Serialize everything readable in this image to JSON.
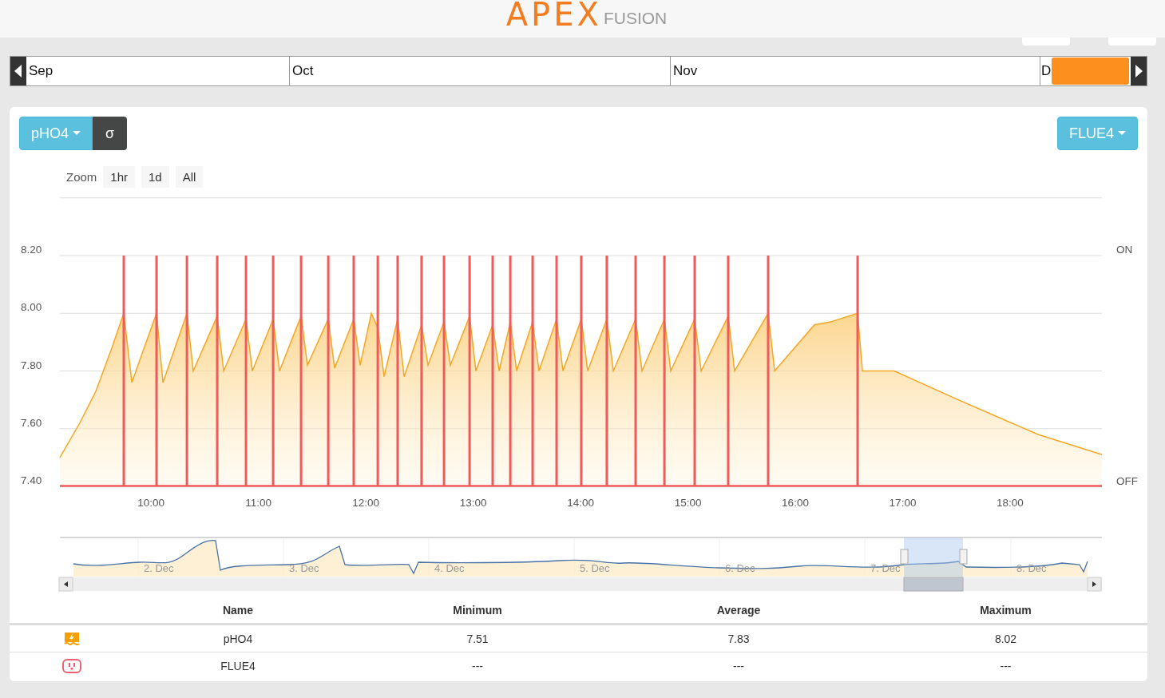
{
  "header": {
    "logo_main": "APEX",
    "logo_sub": "FUSION"
  },
  "timeline": {
    "months": [
      "Sep",
      "Oct",
      "Nov",
      "D"
    ]
  },
  "controls": {
    "sigma_button": "σ",
    "outlet_button": "FLUE4"
  },
  "zoom": {
    "label": "Zoom",
    "buttons": [
      "1hr",
      "1d",
      "All"
    ]
  },
  "chart": {
    "right_axis_labels": [
      "ON",
      "OFF"
    ],
    "chart_data": {
      "type": "area",
      "grid": true,
      "xlim": [
        9.152,
        18.855
      ],
      "ylim": [
        7.4,
        8.4
      ],
      "xticks": [
        {
          "value": 10,
          "label": "10:00"
        },
        {
          "value": 11,
          "label": "11:00"
        },
        {
          "value": 12,
          "label": "12:00"
        },
        {
          "value": 13,
          "label": "13:00"
        },
        {
          "value": 14,
          "label": "14:00"
        },
        {
          "value": 15,
          "label": "15:00"
        },
        {
          "value": 16,
          "label": "16:00"
        },
        {
          "value": 17,
          "label": "17:00"
        },
        {
          "value": 18,
          "label": "18:00"
        }
      ],
      "yticks": [
        {
          "value": 7.4,
          "label": "7.40"
        },
        {
          "value": 7.6,
          "label": "7.60"
        },
        {
          "value": 7.8,
          "label": "7.80"
        },
        {
          "value": 8.0,
          "label": "8.00"
        },
        {
          "value": 8.2,
          "label": "8.20"
        }
      ],
      "x": [
        9.152,
        9.338,
        9.487,
        9.636,
        9.747,
        9.822,
        10.052,
        10.112,
        10.335,
        10.394,
        10.617,
        10.677,
        10.885,
        10.944,
        11.138,
        11.197,
        11.398,
        11.457,
        11.651,
        11.71,
        11.888,
        11.948,
        12.052,
        12.112,
        12.171,
        12.297,
        12.357,
        12.52,
        12.58,
        12.729,
        12.788,
        12.967,
        13.026,
        13.182,
        13.242,
        13.346,
        13.405,
        13.554,
        13.613,
        13.777,
        13.836,
        14.007,
        14.067,
        14.245,
        14.305,
        14.513,
        14.572,
        14.781,
        14.84,
        15.063,
        15.123,
        15.375,
        15.435,
        15.747,
        15.807,
        16.178,
        16.327,
        16.58,
        16.625,
        16.922,
        17.517,
        18.26,
        18.855
      ],
      "series": [
        {
          "name": "pHO4",
          "color": "#f5a623",
          "values": [
            7.5,
            7.62,
            7.73,
            7.88,
            8.0,
            7.76,
            8.0,
            7.76,
            8.0,
            7.8,
            7.99,
            7.8,
            7.98,
            7.8,
            7.98,
            7.8,
            7.99,
            7.82,
            7.98,
            7.81,
            7.98,
            7.82,
            8.0,
            7.95,
            7.78,
            7.98,
            7.78,
            7.96,
            7.82,
            7.97,
            7.82,
            7.99,
            7.8,
            7.96,
            7.8,
            7.97,
            7.8,
            7.97,
            7.8,
            7.98,
            7.8,
            7.98,
            7.8,
            7.98,
            7.8,
            7.98,
            7.8,
            7.98,
            7.8,
            7.98,
            7.8,
            7.99,
            7.8,
            8.0,
            7.8,
            7.96,
            7.97,
            8.0,
            7.8,
            7.8,
            7.7,
            7.58,
            7.51
          ]
        }
      ],
      "ref_lines": [
        {
          "axis": "x",
          "value": 9.747,
          "color": "#f05a5a"
        },
        {
          "axis": "x",
          "value": 10.052,
          "color": "#f05a5a"
        },
        {
          "axis": "x",
          "value": 10.335,
          "color": "#f05a5a"
        },
        {
          "axis": "x",
          "value": 10.617,
          "color": "#f05a5a"
        },
        {
          "axis": "x",
          "value": 10.885,
          "color": "#f05a5a"
        },
        {
          "axis": "x",
          "value": 11.138,
          "color": "#f05a5a"
        },
        {
          "axis": "x",
          "value": 11.398,
          "color": "#f05a5a"
        },
        {
          "axis": "x",
          "value": 11.651,
          "color": "#f05a5a"
        },
        {
          "axis": "x",
          "value": 11.888,
          "color": "#f05a5a"
        },
        {
          "axis": "x",
          "value": 12.112,
          "color": "#f05a5a"
        },
        {
          "axis": "x",
          "value": 12.297,
          "color": "#f05a5a"
        },
        {
          "axis": "x",
          "value": 12.52,
          "color": "#f05a5a"
        },
        {
          "axis": "x",
          "value": 12.729,
          "color": "#f05a5a"
        },
        {
          "axis": "x",
          "value": 12.967,
          "color": "#f05a5a"
        },
        {
          "axis": "x",
          "value": 13.182,
          "color": "#f05a5a"
        },
        {
          "axis": "x",
          "value": 13.346,
          "color": "#f05a5a"
        },
        {
          "axis": "x",
          "value": 13.554,
          "color": "#f05a5a"
        },
        {
          "axis": "x",
          "value": 13.777,
          "color": "#f05a5a"
        },
        {
          "axis": "x",
          "value": 14.007,
          "color": "#f05a5a"
        },
        {
          "axis": "x",
          "value": 14.245,
          "color": "#f05a5a"
        },
        {
          "axis": "x",
          "value": 14.513,
          "color": "#f05a5a"
        },
        {
          "axis": "x",
          "value": 14.781,
          "color": "#f05a5a"
        },
        {
          "axis": "x",
          "value": 15.063,
          "color": "#f05a5a"
        },
        {
          "axis": "x",
          "value": 15.375,
          "color": "#f05a5a"
        },
        {
          "axis": "x",
          "value": 15.747,
          "color": "#f05a5a"
        },
        {
          "axis": "x",
          "value": 16.58,
          "color": "#f05a5a"
        }
      ]
    }
  },
  "navigator": {
    "labels": [
      "2. Dec",
      "3. Dec",
      "4. Dec",
      "5. Dec",
      "6. Dec",
      "7. Dec",
      "8. Dec"
    ]
  },
  "table": {
    "columns": [
      "Name",
      "Minimum",
      "Average",
      "Maximum"
    ],
    "rows": [
      {
        "kind": "probe",
        "cells": [
          "pHO4",
          "7.51",
          "7.83",
          "8.02"
        ]
      },
      {
        "kind": "outlet",
        "cells": [
          "FLUE4",
          "---",
          "---",
          "---"
        ]
      }
    ]
  }
}
